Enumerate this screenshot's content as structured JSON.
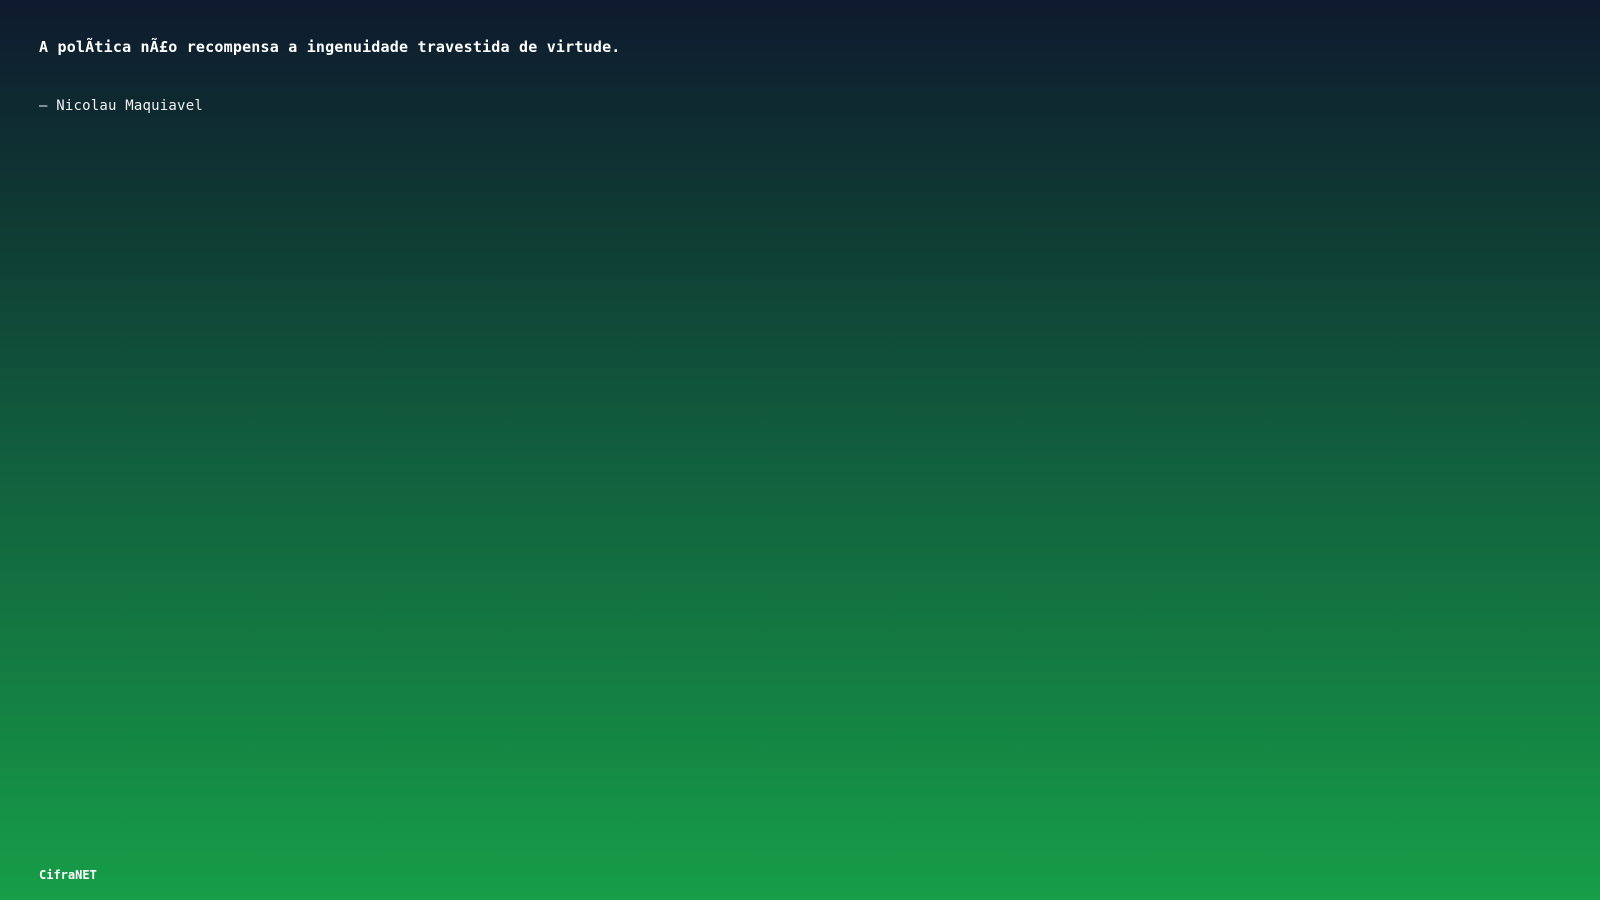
{
  "quote": {
    "text": "A polÃ­tica nÃ£o recompensa a ingenuidade travestida de virtude.",
    "author": "– Nicolau Maquiavel"
  },
  "footer": {
    "brand": "CifraNET"
  },
  "colors": {
    "gradient_top": "#0e1a2e",
    "gradient_bottom": "#169e48",
    "text": "#ffffff"
  }
}
